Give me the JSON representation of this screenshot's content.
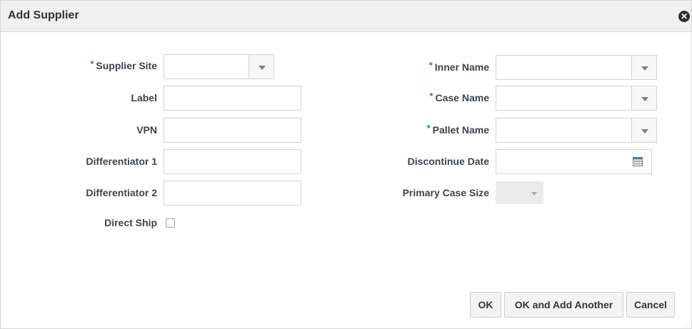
{
  "dialog": {
    "title": "Add Supplier",
    "close_label": "✕"
  },
  "left_fields": {
    "supplier_site": {
      "label": "Supplier Site",
      "required": "*",
      "value": ""
    },
    "label": {
      "label": "Label",
      "value": ""
    },
    "vpn": {
      "label": "VPN",
      "value": ""
    },
    "differentiator_1": {
      "label": "Differentiator 1",
      "value": ""
    },
    "differentiator_2": {
      "label": "Differentiator 2",
      "value": ""
    },
    "direct_ship": {
      "label": "Direct Ship",
      "checked": false
    }
  },
  "right_fields": {
    "inner_name": {
      "label": "Inner Name",
      "required": "*",
      "value": ""
    },
    "case_name": {
      "label": "Case Name",
      "required": "*",
      "value": ""
    },
    "pallet_name": {
      "label": "Pallet Name",
      "required": "*",
      "value": ""
    },
    "discontinue_date": {
      "label": "Discontinue Date",
      "value": ""
    },
    "primary_case_size": {
      "label": "Primary Case Size",
      "value": ""
    }
  },
  "buttons": {
    "ok": "OK",
    "ok_add_another": "OK and Add Another",
    "cancel": "Cancel"
  },
  "icons": {
    "close": "close-icon",
    "dropdown": "chevron-down-icon",
    "calendar": "calendar-icon"
  },
  "colors": {
    "required_marker": "#2c7dc6",
    "title_bar": "#eef1f3"
  }
}
